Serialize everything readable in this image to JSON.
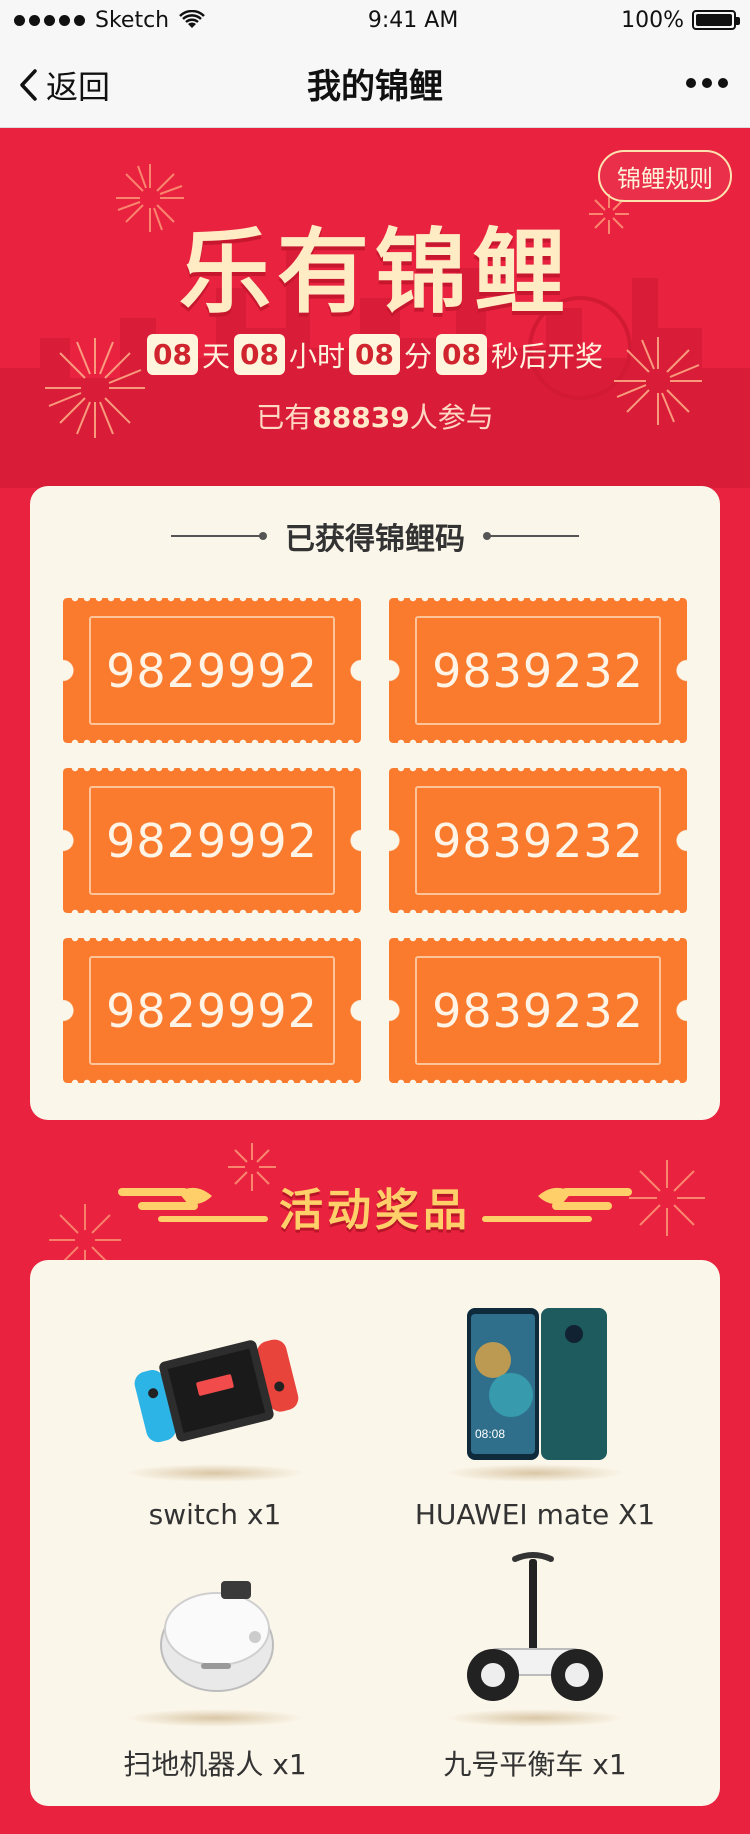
{
  "status_bar": {
    "carrier": "Sketch",
    "time": "9:41 AM",
    "battery": "100%"
  },
  "nav": {
    "back_label": "返回",
    "title": "我的锦鲤"
  },
  "hero": {
    "rules_button": "锦鲤规则",
    "title": "乐有锦鲤",
    "countdown": {
      "days": "08",
      "days_unit": "天",
      "hours": "08",
      "hours_unit": "小时",
      "minutes": "08",
      "minutes_unit": "分",
      "seconds": "08",
      "seconds_unit": "秒后开奖"
    },
    "participants_prefix": "已有",
    "participants_count": "88839",
    "participants_suffix": "人参与"
  },
  "codes": {
    "heading": "已获得锦鲤码",
    "items": [
      "9829992",
      "9839232",
      "9829992",
      "9839232",
      "9829992",
      "9839232"
    ]
  },
  "prizes": {
    "heading": "活动奖品",
    "items": [
      {
        "label": "switch x1",
        "icon": "game-console-icon"
      },
      {
        "label": "HUAWEI mate X1",
        "icon": "smartphone-icon"
      },
      {
        "label": "扫地机器人 x1",
        "icon": "robot-vacuum-icon"
      },
      {
        "label": "九号平衡车 x1",
        "icon": "balance-scooter-icon"
      }
    ]
  },
  "colors": {
    "background": "#E8223F",
    "card": "#FBF6EA",
    "ticket": "#FA7A2E",
    "gold": "#FFCF6A"
  }
}
